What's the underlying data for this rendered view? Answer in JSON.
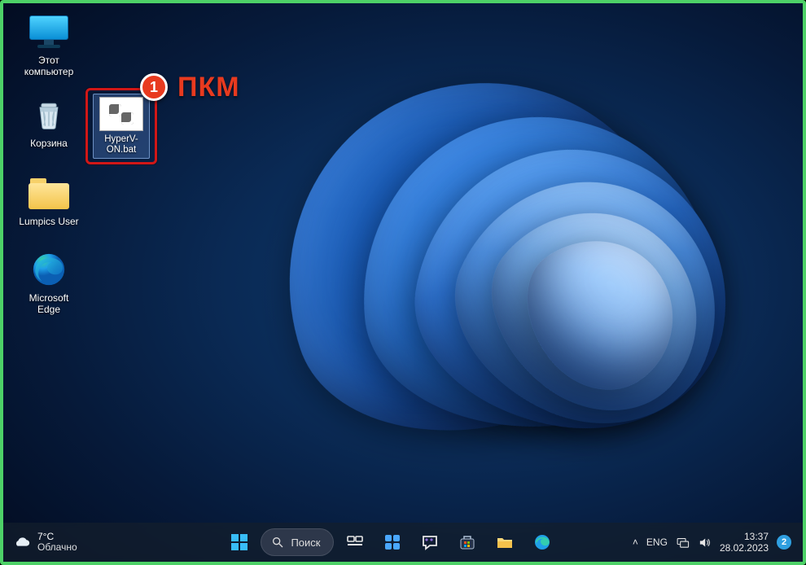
{
  "annotation": {
    "badge": "1",
    "text": "ПКМ"
  },
  "desktop_icons": {
    "this_pc": "Этот\nкомпьютер",
    "recycle_bin": "Корзина",
    "lumpics_folder": "Lumpics User",
    "edge": "Microsoft\nEdge",
    "bat_file": "HyperV-ON.bat"
  },
  "taskbar": {
    "weather": {
      "temp": "7°C",
      "condition": "Облачно"
    },
    "search_label": "Поиск",
    "lang": "ENG",
    "time": "13:37",
    "date": "28.02.2023",
    "notification_count": "2"
  }
}
